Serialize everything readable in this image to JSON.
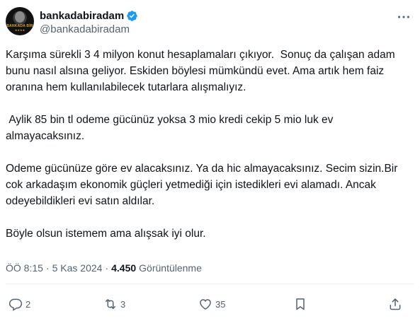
{
  "user": {
    "display_name": "bankadabiradam",
    "handle": "@bankadabiradam",
    "avatar_logo_text": "BANKADA BİR",
    "verified": true
  },
  "tweet": {
    "paragraphs": [
      "Karşıma sürekli 3 4 milyon konut hesaplamaları çıkıyor.  Sonuç da çalışan adam bunu nasıl alsına geliyor. Eskiden böylesi mümkündü evet. Ama artık hem faiz oranına hem kullanılabilecek tutarlara alışmalıyız.",
      " Aylik 85 bin tl odeme gücünüz yoksa 3 mio kredi cekip 5 mio luk ev almayacaksınız.",
      "Odeme gücünüze göre ev alacaksınız. Ya da hic almayacaksınız. Secim sizin.Bir cok arkadaşım ekonomik güçleri yetmediği için istedikleri evi alamadı. Ancak odeyebildikleri evi satın aldılar.",
      "Böyle olsun istemem ama alışsak iyi olur."
    ]
  },
  "meta": {
    "time": "ÖÖ 8:15",
    "separator": "·",
    "date": "5 Kas 2024",
    "views_count": "4.450",
    "views_label": "Görüntülenme"
  },
  "actions": {
    "replies": "2",
    "reposts": "3",
    "likes": "35"
  },
  "colors": {
    "text": "#0f1419",
    "secondary": "#536471",
    "verified": "#1d9bf0"
  }
}
